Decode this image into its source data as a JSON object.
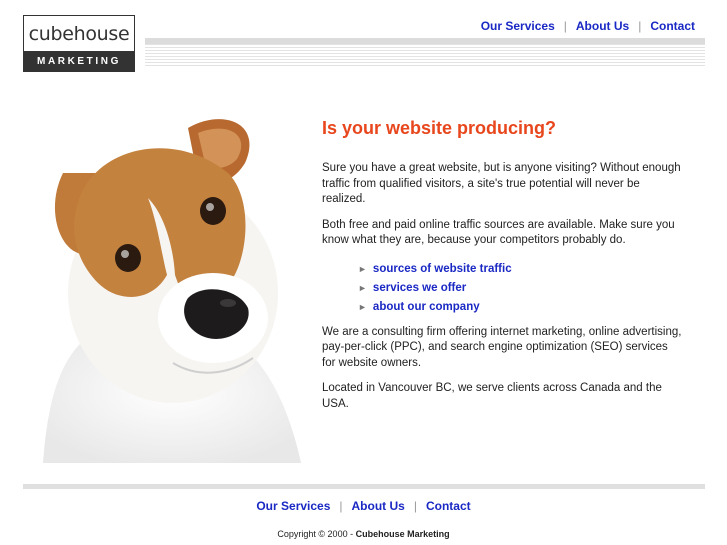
{
  "logo": {
    "top": "cubehouse",
    "bottom": "MARKETING"
  },
  "topnav": [
    {
      "label": "Our Services"
    },
    {
      "label": "About Us"
    },
    {
      "label": "Contact"
    }
  ],
  "nav_separator": "|",
  "main": {
    "headline": "Is your website producing?",
    "para1": "Sure you have a great website, but is anyone visiting? Without enough traffic from qualified visitors, a site's true potential will never be realized.",
    "para2": "Both free and paid online traffic sources are available. Make sure you know what they are, because your competitors probably do.",
    "links": [
      {
        "label": "sources of website traffic"
      },
      {
        "label": "services we offer"
      },
      {
        "label": "about our company"
      }
    ],
    "para3": "We are a consulting firm offering internet marketing, online advertising, pay-per-click (PPC), and search engine optimization (SEO) services for website owners.",
    "para4": "Located in Vancouver BC, we serve clients across Canada and the USA."
  },
  "footnav": [
    {
      "label": "Our Services"
    },
    {
      "label": "About Us"
    },
    {
      "label": "Contact"
    }
  ],
  "copyright": {
    "text": "Copyright © 2000 - ",
    "company": "Cubehouse Marketing"
  },
  "colors": {
    "headline": "#e8461c",
    "link": "#1a28c4",
    "logo_bar": "#333333"
  },
  "icons": {
    "bullet": "triangle-right-icon"
  }
}
